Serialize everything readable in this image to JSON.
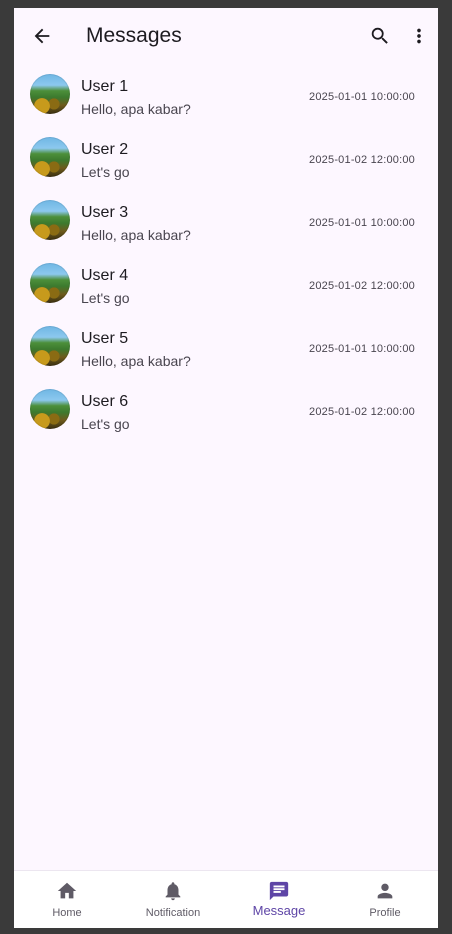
{
  "appbar": {
    "title": "Messages",
    "back_icon": "arrow-back-icon",
    "search_icon": "search-icon",
    "more_icon": "more-vert-icon"
  },
  "messages": [
    {
      "name": "User 1",
      "preview": "Hello, apa kabar?",
      "time": "2025-01-01 10:00:00"
    },
    {
      "name": "User 2",
      "preview": "Let's go",
      "time": "2025-01-02 12:00:00"
    },
    {
      "name": "User 3",
      "preview": "Hello, apa kabar?",
      "time": "2025-01-01 10:00:00"
    },
    {
      "name": "User 4",
      "preview": "Let's go",
      "time": "2025-01-02 12:00:00"
    },
    {
      "name": "User 5",
      "preview": "Hello, apa kabar?",
      "time": "2025-01-01 10:00:00"
    },
    {
      "name": "User 6",
      "preview": "Let's go",
      "time": "2025-01-02 12:00:00"
    }
  ],
  "bottom_nav": {
    "items": [
      {
        "label": "Home",
        "icon": "home-icon",
        "active": false
      },
      {
        "label": "Notification",
        "icon": "bell-icon",
        "active": false
      },
      {
        "label": "Message",
        "icon": "message-icon",
        "active": true
      },
      {
        "label": "Profile",
        "icon": "person-icon",
        "active": false
      }
    ]
  },
  "colors": {
    "background": "#fdf7ff",
    "active_nav": "#5e45a6",
    "text_primary": "#1d1b20",
    "text_secondary": "#49454f"
  }
}
